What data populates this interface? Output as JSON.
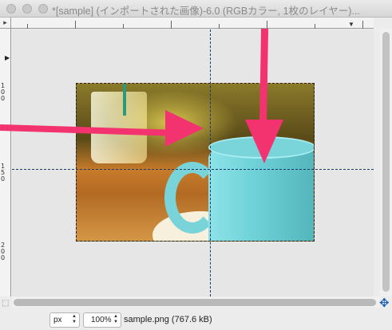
{
  "window": {
    "title": "*[sample] (インポートされた画像)-6.0 (RGBカラー, 1枚のレイヤー)..."
  },
  "rulers": {
    "left_labels": [
      "1",
      "0",
      "0",
      "1",
      "5",
      "0",
      "2",
      "0",
      "0"
    ]
  },
  "statusbar": {
    "unit": "px",
    "zoom": "100%",
    "status": "sample.png (767.6 kB)"
  },
  "colors": {
    "arrow": "#f2336f",
    "guide": "#1a3a6a",
    "mug": "#6fd3d9"
  },
  "icons": {
    "corner": "quick-mask-icon",
    "navigate": "navigate-icon"
  }
}
